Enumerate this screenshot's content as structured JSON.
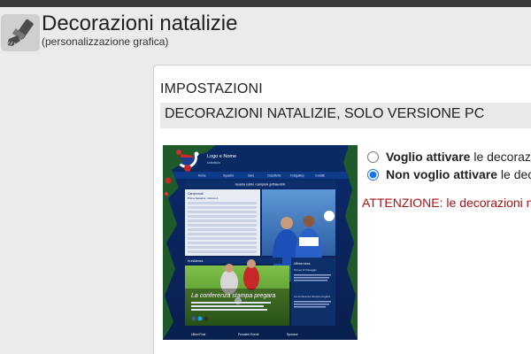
{
  "header": {
    "title": "Decorazioni natalizie",
    "subtitle": "(personalizzazione grafica)",
    "icon": "paintbrush-icon"
  },
  "settings": {
    "section_label": "IMPOSTAZIONI",
    "section_heading": "DECORAZIONI NATALIZIE, SOLO VERSIONE PC",
    "options": [
      {
        "bold": "Voglio attivare",
        "rest": " le decorazi",
        "checked": false
      },
      {
        "bold": "Non voglio attivare",
        "rest": " le dec",
        "checked": true
      }
    ],
    "warning": "ATTENZIONE: le decorazioni n"
  },
  "preview": {
    "site_title": "Logo e Nome",
    "site_subtitle": "sottotitolo",
    "nav_items": [
      "Home",
      "Squadra",
      "Gare",
      "Classifiche",
      "Fotogallery",
      "Contatti"
    ],
    "content_heading": "Guarda subito i campioni goffolandini!",
    "table_title": "Campionati",
    "table_subtitle": "Prima Squadra - Girone A",
    "side_heading": "Ultime news",
    "side_title": "Torneo di Viareggio",
    "side_title2": "La conferenza stampa pregara",
    "news_heading": "In evidenza",
    "feature_caption": "La conferenza stampa pregara",
    "footer_cols": [
      "Ultimi Post",
      "Prossimi Eventi",
      "Sponsor"
    ],
    "colors": {
      "accent": "#1a73e8",
      "warning": "#a31515"
    }
  }
}
